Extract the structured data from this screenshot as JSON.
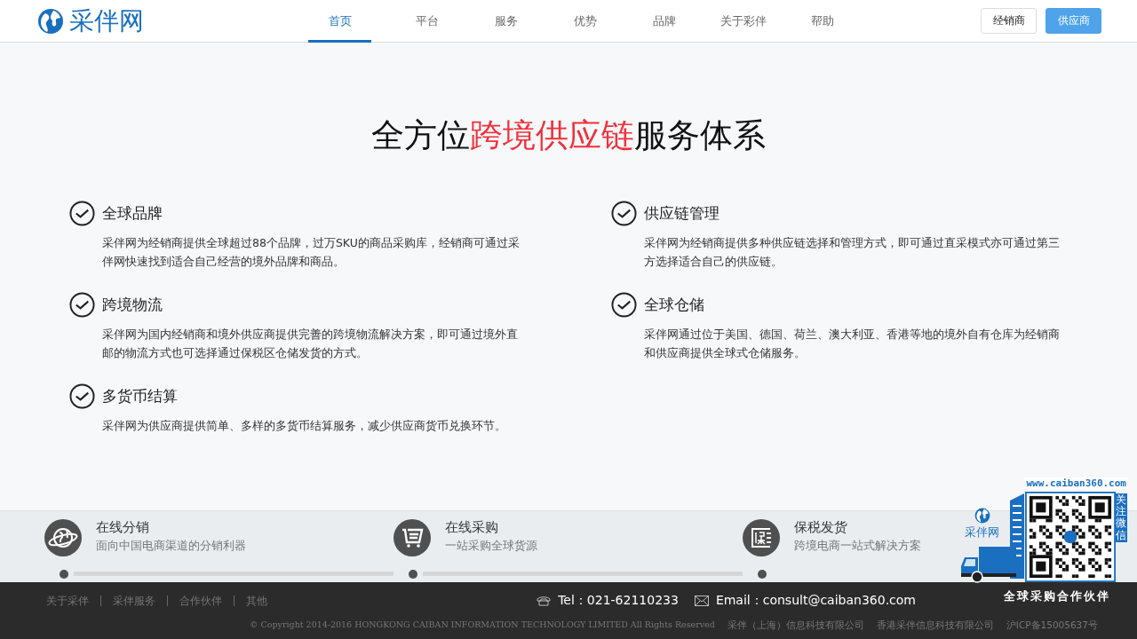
{
  "header": {
    "logo_text": "采伴网",
    "nav": [
      {
        "label": "首页",
        "selected": true
      },
      {
        "label": "平台",
        "selected": false
      },
      {
        "label": "服务",
        "selected": false
      },
      {
        "label": "优势",
        "selected": false
      },
      {
        "label": "品牌",
        "selected": false
      },
      {
        "label": "关于彩伴",
        "selected": false
      },
      {
        "label": "帮助",
        "selected": false
      }
    ],
    "buttons": [
      {
        "label": "经销商",
        "kind": "outline"
      },
      {
        "label": "供应商",
        "kind": "primary"
      }
    ]
  },
  "headline": {
    "before": "全方位",
    "highlight": "跨境供应链",
    "after": "服务体系"
  },
  "features": [
    {
      "title": "全球品牌",
      "text": "采伴网为经销商提供全球超过88个品牌，过万SKU的商品采购库，经销商可通过采伴网快速找到适合自己经营的境外品牌和商品。"
    },
    {
      "title": "供应链管理",
      "text": "采伴网为经销商提供多种供应链选择和管理方式，即可通过直采模式亦可通过第三方选择适合自己的供应链。"
    },
    {
      "title": "跨境物流",
      "text": "采伴网为国内经销商和境外供应商提供完善的跨境物流解决方案，即可通过境外直邮的物流方式也可选择通过保税区仓储发货的方式。"
    },
    {
      "title": "全球仓储",
      "text": "采伴网通过位于美国、德国、荷兰、澳大利亚、香港等地的境外自有仓库为经销商和供应商提供全球式仓储服务。"
    },
    {
      "title": "多货币结算",
      "text": "采伴网为供应商提供简单、多样的多货币结算服务，减少供应商货币兑换环节。"
    }
  ],
  "services": [
    {
      "kind": "globe",
      "title": "在线分销",
      "subtitle": "面向中国电商渠道的分销利器"
    },
    {
      "kind": "cart",
      "title": "在线采购",
      "subtitle": "一站采购全球货源"
    },
    {
      "kind": "bonded",
      "title": "保税发货",
      "subtitle": "跨境电商一站式解决方案"
    }
  ],
  "footer": {
    "links": [
      "关于采伴",
      "采伴服务",
      "合作伙伴",
      "其他"
    ],
    "tel": "Tel：021-62110233",
    "email": "Email：consult@caiban360.com",
    "legal": [
      "© Copyright 2014-2016 HONGKONG CAIBAN INFORMATION TECHNOLOGY LIMITED All Rights Reserved",
      "采伴（上海）信息科技有限公司",
      "香港采伴信息科技有限公司",
      "沪ICP备15005637号"
    ]
  },
  "promo": {
    "url": "www.caiban360.com",
    "follow": "关注微信",
    "logo_text": "采伴网",
    "slogan": "全球采购合作伙伴"
  }
}
